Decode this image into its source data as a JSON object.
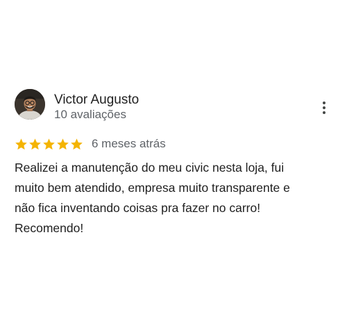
{
  "review": {
    "reviewer_name": "Victor Augusto",
    "reviewer_meta": "10 avaliações",
    "rating": 5,
    "rating_max": 5,
    "date": "6 meses atrás",
    "text": "Realizei a manutenção do meu civic nesta loja, fui\nmuito bem atendido, empresa muito transparente e\nnão fica inventando coisas pra fazer no carro!\nRecomendo!"
  },
  "icons": {
    "avatar": "user-avatar-photo",
    "more": "more-vert-icon",
    "star": "star-icon"
  },
  "colors": {
    "star": "#f4b400",
    "text_primary": "#1f1f1f",
    "text_secondary": "#5f6368",
    "background": "#ffffff"
  }
}
